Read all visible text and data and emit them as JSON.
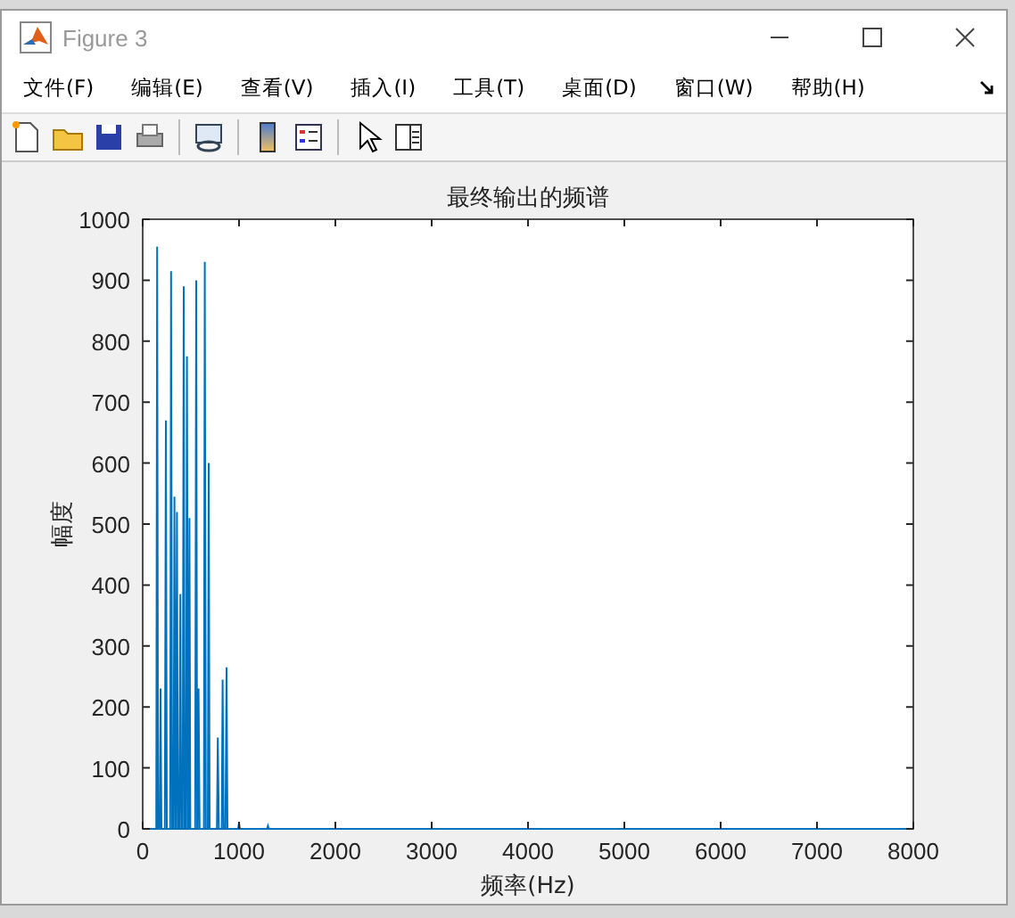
{
  "window": {
    "title": "Figure 3"
  },
  "menu": [
    "文件(F)",
    "编辑(E)",
    "查看(V)",
    "插入(I)",
    "工具(T)",
    "桌面(D)",
    "窗口(W)",
    "帮助(H)"
  ],
  "figure": {
    "chart_data": {
      "type": "line",
      "title": "最终输出的频谱",
      "xlabel": "频率(Hz)",
      "ylabel": "幅度",
      "x": [
        0,
        140,
        150,
        160,
        175,
        185,
        195,
        230,
        240,
        250,
        285,
        295,
        305,
        320,
        330,
        340,
        345,
        355,
        365,
        380,
        390,
        400,
        415,
        425,
        435,
        450,
        460,
        470,
        475,
        485,
        495,
        545,
        555,
        565,
        570,
        580,
        590,
        635,
        645,
        655,
        675,
        685,
        695,
        770,
        780,
        790,
        820,
        830,
        840,
        860,
        870,
        880,
        990,
        1000,
        1010,
        1290,
        1300,
        1310,
        8000
      ],
      "series": [
        {
          "color": "#0072bd",
          "values": [
            0,
            0,
            955,
            0,
            0,
            230,
            0,
            0,
            670,
            0,
            0,
            915,
            0,
            0,
            545,
            0,
            0,
            520,
            0,
            0,
            385,
            0,
            0,
            890,
            0,
            0,
            775,
            0,
            0,
            510,
            0,
            0,
            900,
            0,
            0,
            230,
            0,
            0,
            930,
            0,
            0,
            600,
            0,
            0,
            150,
            0,
            0,
            245,
            0,
            0,
            265,
            0,
            0,
            10,
            0,
            0,
            5,
            0,
            0
          ]
        }
      ],
      "xlim": [
        0,
        8000
      ],
      "ylim": [
        0,
        1000
      ],
      "xticks": [
        0,
        1000,
        2000,
        3000,
        4000,
        5000,
        6000,
        7000,
        8000
      ],
      "yticks": [
        0,
        100,
        200,
        300,
        400,
        500,
        600,
        700,
        800,
        900,
        1000
      ]
    }
  }
}
